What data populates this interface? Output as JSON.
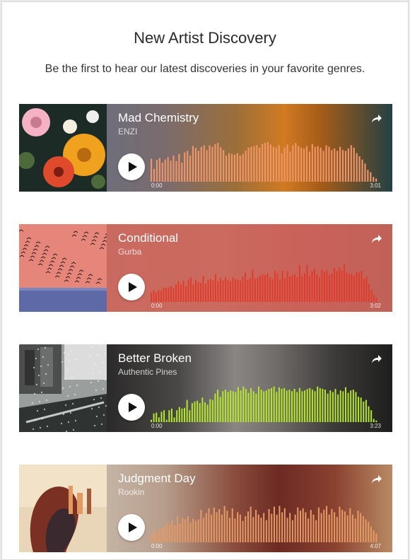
{
  "header": {
    "title": "New Artist Discovery",
    "subtitle": "Be the first to hear our latest discoveries in your favorite genres."
  },
  "players": [
    {
      "title": "Mad Chemistry",
      "artist": "ENZI",
      "start_time": "0:00",
      "duration": "3:01",
      "bar_color": "#f0956a",
      "bg": "linear-gradient(90deg,#6e6e7a 0%,#7a6b6e 20%,#9b6f3a 45%,#d17a22 62%,#a55c18 75%,#224044 100%)",
      "art_palette": [
        "#1d2b26",
        "#f0a11d",
        "#e04a2c",
        "#f4b2c4",
        "#4f6a3a"
      ],
      "wave": [
        0.58,
        0.32,
        0.55,
        0.6,
        0.48,
        0.56,
        0.62,
        0.53,
        0.66,
        0.52,
        0.7,
        0.48,
        0.74,
        0.78,
        0.66,
        0.9,
        0.85,
        0.78,
        0.88,
        0.92,
        0.8,
        0.92,
        0.88,
        0.95,
        0.98,
        0.87,
        0.8,
        0.66,
        0.72,
        0.7,
        0.68,
        0.72,
        0.66,
        0.7,
        0.78,
        0.86,
        0.88,
        0.9,
        0.92,
        0.86,
        0.95,
        0.98,
        1.0,
        0.94,
        0.88,
        0.86,
        0.92,
        0.72,
        0.86,
        0.94,
        0.76,
        0.92,
        0.98,
        0.9,
        0.86,
        0.84,
        0.9,
        0.76,
        0.95,
        0.88,
        0.9,
        0.86,
        0.78,
        0.92,
        0.88,
        0.8,
        0.84,
        0.78,
        0.88,
        0.8,
        0.78,
        0.84,
        0.92,
        0.86,
        0.72,
        0.64,
        0.56,
        0.46,
        0.3,
        0.24,
        0.12,
        0.08
      ]
    },
    {
      "title": "Conditional",
      "artist": "Gurba",
      "start_time": "0:00",
      "duration": "3:02",
      "bar_color": "#e23a28",
      "bg": "linear-gradient(90deg,#c96a60 0%,#cb6a5e 40%,#c9625a 70%,#c06258 100%)",
      "art_palette": [
        "#e27e6e",
        "#5e6aa8",
        "#2a1a18",
        "#f0b090",
        "#7a86c0"
      ],
      "wave": [
        0.24,
        0.3,
        0.24,
        0.3,
        0.28,
        0.36,
        0.36,
        0.36,
        0.4,
        0.36,
        0.44,
        0.52,
        0.44,
        0.54,
        0.4,
        0.56,
        0.62,
        0.44,
        0.56,
        0.5,
        0.48,
        0.66,
        0.46,
        0.56,
        0.58,
        0.54,
        0.7,
        0.52,
        0.6,
        0.54,
        0.62,
        0.56,
        0.52,
        0.62,
        0.58,
        0.56,
        0.54,
        0.64,
        0.74,
        0.56,
        0.6,
        0.82,
        0.58,
        0.62,
        0.66,
        0.7,
        0.68,
        0.72,
        0.62,
        0.58,
        0.78,
        0.72,
        0.56,
        0.8,
        0.6,
        0.78,
        0.64,
        0.68,
        0.7,
        0.62,
        0.92,
        0.64,
        0.72,
        0.94,
        0.66,
        0.78,
        0.84,
        0.7,
        0.62,
        0.82,
        0.76,
        0.8,
        0.68,
        0.72,
        0.86,
        0.78,
        0.88,
        0.8,
        0.94,
        0.74,
        0.7,
        0.72,
        0.66,
        0.76,
        0.74,
        0.78,
        0.58,
        0.64,
        0.46,
        0.3,
        0.18,
        0.1
      ]
    },
    {
      "title": "Better Broken",
      "artist": "Authentic Pines",
      "start_time": "0:00",
      "duration": "3:23",
      "bar_color": "#b6e82a",
      "bg": "linear-gradient(90deg,#2b2a2a 0%,#4a4846 25%,#8a8684 45%,#6e6b68 60%,#3c3a38 80%,#1e1e1e 100%)",
      "art_palette": [
        "#9a9e9c",
        "#4b4e4c",
        "#dcdcdc",
        "#2f3432",
        "#c4c8c6"
      ],
      "wave": [
        0.06,
        0.22,
        0.24,
        0.12,
        0.26,
        0.3,
        0.06,
        0.3,
        0.34,
        0.12,
        0.3,
        0.38,
        0.34,
        0.36,
        0.56,
        0.3,
        0.48,
        0.52,
        0.54,
        0.48,
        0.62,
        0.5,
        0.44,
        0.58,
        0.56,
        0.72,
        0.82,
        0.64,
        0.78,
        0.82,
        0.76,
        0.8,
        0.78,
        0.76,
        0.88,
        0.8,
        0.9,
        0.84,
        0.74,
        0.86,
        0.78,
        0.72,
        0.9,
        0.82,
        0.78,
        0.8,
        0.84,
        0.86,
        0.9,
        0.76,
        0.88,
        0.84,
        0.86,
        0.8,
        0.82,
        0.78,
        0.84,
        0.76,
        0.86,
        0.78,
        0.8,
        0.84,
        0.86,
        0.82,
        0.78,
        0.9,
        0.86,
        0.84,
        0.82,
        0.72,
        0.8,
        0.76,
        0.84,
        0.7,
        0.8,
        0.78,
        0.88,
        0.74,
        0.8,
        0.82,
        0.76,
        0.64,
        0.62,
        0.52,
        0.56,
        0.4,
        0.3,
        0.08,
        0.04
      ]
    },
    {
      "title": "Judgment Day",
      "artist": "Rookin",
      "start_time": "0:00",
      "duration": "4:07",
      "bar_color": "#e59a64",
      "bg": "linear-gradient(90deg,#c4b3a4 0%,#b89e8c 20%,#8a4c3c 45%,#6c2a24 60%,#8a4230 80%,#b98a64 100%)",
      "art_palette": [
        "#f2e2c8",
        "#7a3022",
        "#3a2a30",
        "#e29a60",
        "#c8b8a8"
      ],
      "wave": [
        0.18,
        0.3,
        0.24,
        0.36,
        0.34,
        0.4,
        0.5,
        0.46,
        0.56,
        0.44,
        0.66,
        0.48,
        0.62,
        0.58,
        0.66,
        0.5,
        0.6,
        0.54,
        0.58,
        0.82,
        0.62,
        0.74,
        0.86,
        0.7,
        0.88,
        0.76,
        0.84,
        0.7,
        0.92,
        0.8,
        0.62,
        0.86,
        0.6,
        0.76,
        0.7,
        0.54,
        0.66,
        0.78,
        0.9,
        0.64,
        0.82,
        0.7,
        0.62,
        0.74,
        0.56,
        0.84,
        0.72,
        0.9,
        0.7,
        0.92,
        0.76,
        0.86,
        0.62,
        0.74,
        0.56,
        0.7,
        0.88,
        0.8,
        0.86,
        0.76,
        0.6,
        0.82,
        0.7,
        0.56,
        0.88,
        0.74,
        0.82,
        0.92,
        0.7,
        0.84,
        0.76,
        0.64,
        0.9,
        0.82,
        0.78,
        0.68,
        0.86,
        0.7,
        0.6,
        0.8,
        0.74,
        0.66,
        0.58,
        0.52,
        0.4,
        0.3,
        0.22
      ]
    }
  ]
}
